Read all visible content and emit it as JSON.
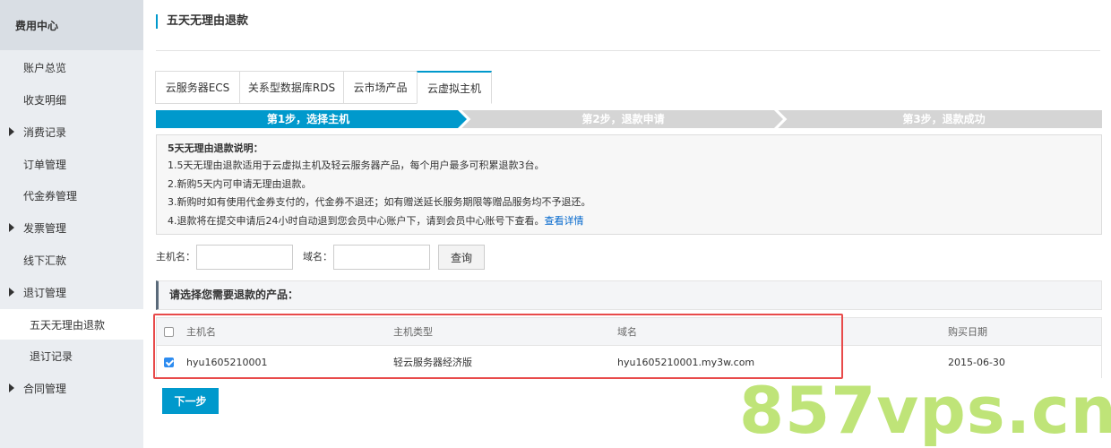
{
  "sidebar": {
    "title": "费用中心",
    "items": [
      {
        "label": "账户总览",
        "expandable": false
      },
      {
        "label": "收支明细",
        "expandable": false
      },
      {
        "label": "消费记录",
        "expandable": true
      },
      {
        "label": "订单管理",
        "expandable": false
      },
      {
        "label": "代金券管理",
        "expandable": false
      },
      {
        "label": "发票管理",
        "expandable": true
      },
      {
        "label": "线下汇款",
        "expandable": false
      },
      {
        "label": "退订管理",
        "expandable": true
      },
      {
        "label": "五天无理由退款",
        "expandable": false,
        "active": true
      },
      {
        "label": "退订记录",
        "expandable": false
      },
      {
        "label": "合同管理",
        "expandable": true
      }
    ]
  },
  "page": {
    "title": "五天无理由退款"
  },
  "tabs": [
    "云服务器ECS",
    "关系型数据库RDS",
    "云市场产品",
    "云虚拟主机"
  ],
  "active_tab": "云虚拟主机",
  "steps": [
    "第1步，选择主机",
    "第2步，退款申请",
    "第3步，退款成功"
  ],
  "colors": {
    "accent": "#0099cc",
    "step_active": "#0099cc",
    "step_inactive": "#d5d5d5",
    "highlight": "#e84a4a",
    "watermark": "#b9e26a"
  },
  "notice": {
    "title": "5天无理由退款说明：",
    "lines": [
      "1.5天无理由退款适用于云虚拟主机及轻云服务器产品，每个用户最多可积累退款3台。",
      "2.新购5天内可申请无理由退款。",
      "3.新购时如有使用代金券支付的，代金券不退还；如有赠送延长服务期限等赠品服务均不予退还。",
      "4.退款将在提交申请后24小时自动退到您会员中心账户下，请到会员中心账号下查看。"
    ],
    "link": "查看详情"
  },
  "search": {
    "host_label": "主机名：",
    "host_value": "",
    "domain_label": "域名：",
    "domain_value": "",
    "button": "查询"
  },
  "section": {
    "title": "请选择您需要退款的产品："
  },
  "table": {
    "columns": [
      "主机名",
      "主机类型",
      "域名",
      "购买日期"
    ],
    "rows": [
      {
        "checked": true,
        "host": "hyu1605210001",
        "type": "轻云服务器经济版",
        "domain": "hyu1605210001.my3w.com",
        "date": "2015-06-30"
      }
    ]
  },
  "next_button": "下一步",
  "watermark": "857vps.cn"
}
